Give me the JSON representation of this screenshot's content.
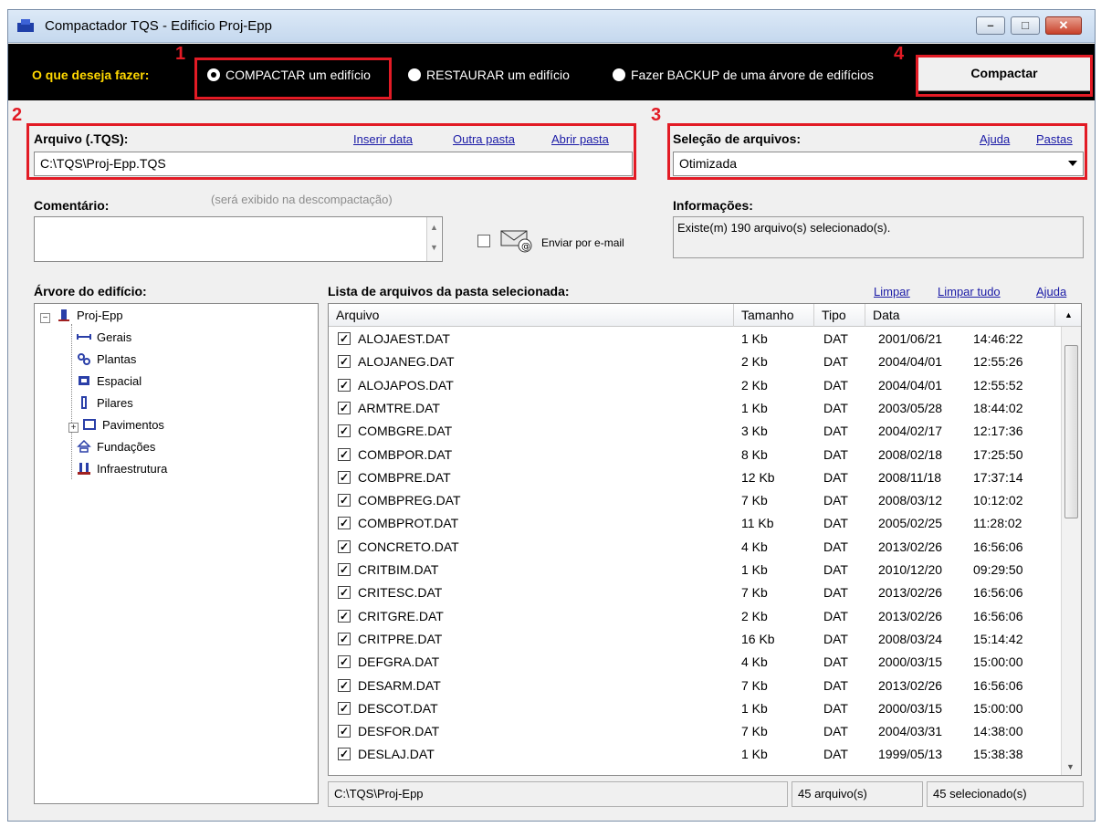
{
  "window": {
    "title": "Compactador TQS - Edificio Proj-Epp",
    "minimize_label": "–",
    "maximize_label": "□",
    "close_label": "✕"
  },
  "topbar": {
    "question": "O que deseja fazer:",
    "options": [
      "COMPACTAR um edifício",
      "RESTAURAR um edifício",
      "Fazer BACKUP de uma árvore de edifícios"
    ],
    "selected_option": "COMPACTAR um edifício",
    "action_button": "Compactar"
  },
  "annotations": [
    "1",
    "2",
    "3",
    "4"
  ],
  "file": {
    "label": "Arquivo (.TQS):",
    "value": "C:\\TQS\\Proj-Epp.TQS",
    "links": [
      "Inserir data",
      "Outra pasta",
      "Abrir pasta"
    ]
  },
  "selection": {
    "label": "Seleção de arquivos:",
    "links": [
      "Ajuda",
      "Pastas"
    ],
    "value": "Otimizada"
  },
  "comment": {
    "label": "Comentário:",
    "hint": "(será exibido na descompactação)",
    "value": "",
    "email_label": "Enviar por e-mail",
    "email_checked": false
  },
  "info": {
    "label": "Informações:",
    "text": "Existe(m) 190 arquivo(s) selecionado(s)."
  },
  "tree": {
    "label": "Árvore do edifício:",
    "root": "Proj-Epp",
    "items": [
      "Gerais",
      "Plantas",
      "Espacial",
      "Pilares",
      "Pavimentos",
      "Fundações",
      "Infraestrutura"
    ]
  },
  "list": {
    "label": "Lista de arquivos da pasta selecionada:",
    "links": [
      "Limpar",
      "Limpar tudo",
      "Ajuda"
    ],
    "columns": [
      "Arquivo",
      "Tamanho",
      "Tipo",
      "Data"
    ],
    "rows": [
      {
        "name": "ALOJAEST.DAT",
        "size": "1 Kb",
        "type": "DAT",
        "date": "2001/06/21",
        "time": "14:46:22"
      },
      {
        "name": "ALOJANEG.DAT",
        "size": "2 Kb",
        "type": "DAT",
        "date": "2004/04/01",
        "time": "12:55:26"
      },
      {
        "name": "ALOJAPOS.DAT",
        "size": "2 Kb",
        "type": "DAT",
        "date": "2004/04/01",
        "time": "12:55:52"
      },
      {
        "name": "ARMTRE.DAT",
        "size": "1 Kb",
        "type": "DAT",
        "date": "2003/05/28",
        "time": "18:44:02"
      },
      {
        "name": "COMBGRE.DAT",
        "size": "3 Kb",
        "type": "DAT",
        "date": "2004/02/17",
        "time": "12:17:36"
      },
      {
        "name": "COMBPOR.DAT",
        "size": "8 Kb",
        "type": "DAT",
        "date": "2008/02/18",
        "time": "17:25:50"
      },
      {
        "name": "COMBPRE.DAT",
        "size": "12 Kb",
        "type": "DAT",
        "date": "2008/11/18",
        "time": "17:37:14"
      },
      {
        "name": "COMBPREG.DAT",
        "size": "7 Kb",
        "type": "DAT",
        "date": "2008/03/12",
        "time": "10:12:02"
      },
      {
        "name": "COMBPROT.DAT",
        "size": "11 Kb",
        "type": "DAT",
        "date": "2005/02/25",
        "time": "11:28:02"
      },
      {
        "name": "CONCRETO.DAT",
        "size": "4 Kb",
        "type": "DAT",
        "date": "2013/02/26",
        "time": "16:56:06"
      },
      {
        "name": "CRITBIM.DAT",
        "size": "1 Kb",
        "type": "DAT",
        "date": "2010/12/20",
        "time": "09:29:50"
      },
      {
        "name": "CRITESC.DAT",
        "size": "7 Kb",
        "type": "DAT",
        "date": "2013/02/26",
        "time": "16:56:06"
      },
      {
        "name": "CRITGRE.DAT",
        "size": "2 Kb",
        "type": "DAT",
        "date": "2013/02/26",
        "time": "16:56:06"
      },
      {
        "name": "CRITPRE.DAT",
        "size": "16 Kb",
        "type": "DAT",
        "date": "2008/03/24",
        "time": "15:14:42"
      },
      {
        "name": "DEFGRA.DAT",
        "size": "4 Kb",
        "type": "DAT",
        "date": "2000/03/15",
        "time": "15:00:00"
      },
      {
        "name": "DESARM.DAT",
        "size": "7 Kb",
        "type": "DAT",
        "date": "2013/02/26",
        "time": "16:56:06"
      },
      {
        "name": "DESCOT.DAT",
        "size": "1 Kb",
        "type": "DAT",
        "date": "2000/03/15",
        "time": "15:00:00"
      },
      {
        "name": "DESFOR.DAT",
        "size": "7 Kb",
        "type": "DAT",
        "date": "2004/03/31",
        "time": "14:38:00"
      },
      {
        "name": "DESLAJ.DAT",
        "size": "1 Kb",
        "type": "DAT",
        "date": "1999/05/13",
        "time": "15:38:38"
      }
    ]
  },
  "statusbar": {
    "path": "C:\\TQS\\Proj-Epp",
    "count": "45 arquivo(s)",
    "selected": "45 selecionado(s)"
  },
  "colors": {
    "accent_red": "#e21b25",
    "topbar_bg": "#000000",
    "question_yellow": "#ffd800",
    "link_blue": "#1a1aa6"
  },
  "icons": [
    "app-icon",
    "radio-selected-icon",
    "radio-icon",
    "dropdown-arrow-icon",
    "email-icon",
    "building-icon",
    "tree-item-icon",
    "checkbox-checked-icon",
    "scroll-up-icon",
    "scroll-down-icon"
  ]
}
